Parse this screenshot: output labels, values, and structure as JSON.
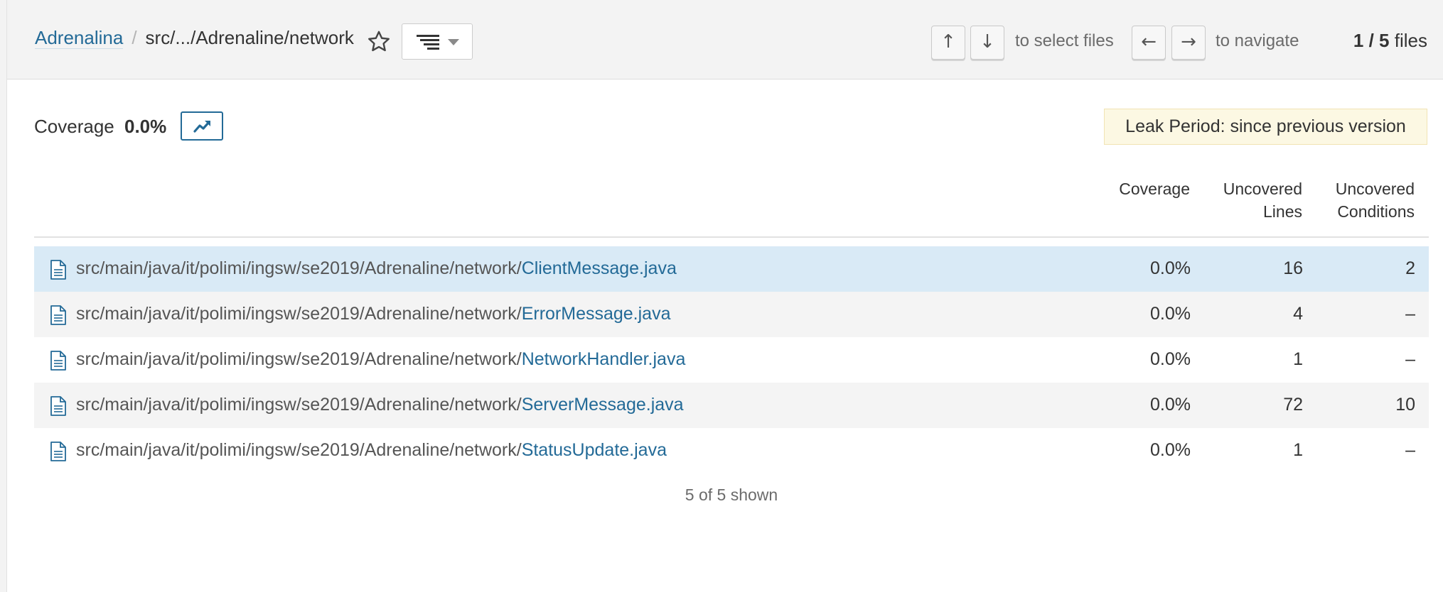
{
  "header": {
    "project": "Adrenalina",
    "separator": "/",
    "path": "src/.../Adrenaline/network",
    "select_hint": "to select files",
    "navigate_hint": "to navigate",
    "up_key": "↑",
    "down_key": "↓",
    "left_key": "←",
    "right_key": "→",
    "files_current": "1 / 5",
    "files_suffix": "files"
  },
  "measure": {
    "label": "Coverage",
    "value": "0.0%",
    "leak_period": "Leak Period: since previous version"
  },
  "table": {
    "columns": [
      {
        "line1": "Coverage",
        "line2": ""
      },
      {
        "line1": "Uncovered",
        "line2": "Lines"
      },
      {
        "line1": "Uncovered",
        "line2": "Conditions"
      }
    ],
    "dir_prefix": "src/main/java/it/polimi/ingsw/se2019/Adrenaline/network/",
    "rows": [
      {
        "file": "ClientMessage.java",
        "coverage": "0.0%",
        "uncovered_lines": "16",
        "uncovered_conditions": "2"
      },
      {
        "file": "ErrorMessage.java",
        "coverage": "0.0%",
        "uncovered_lines": "4",
        "uncovered_conditions": "–"
      },
      {
        "file": "NetworkHandler.java",
        "coverage": "0.0%",
        "uncovered_lines": "1",
        "uncovered_conditions": "–"
      },
      {
        "file": "ServerMessage.java",
        "coverage": "0.0%",
        "uncovered_lines": "72",
        "uncovered_conditions": "10"
      },
      {
        "file": "StatusUpdate.java",
        "coverage": "0.0%",
        "uncovered_lines": "1",
        "uncovered_conditions": "–"
      }
    ],
    "shown": "5 of 5 shown"
  },
  "icons": {
    "favorite": "star-outline-icon",
    "view": "list-tree-icon",
    "trend": "chart-trend-icon",
    "file": "file-icon"
  },
  "colors": {
    "link": "#236a97",
    "selected_row": "#d9eaf6",
    "leak_bg": "#fcf8e3",
    "header_bg": "#f3f3f3"
  }
}
